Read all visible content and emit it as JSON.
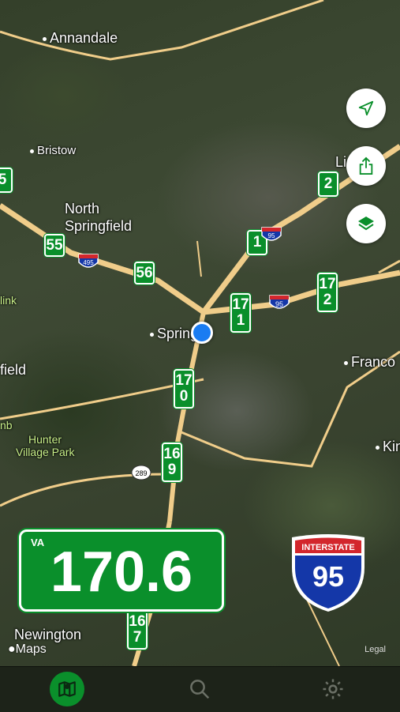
{
  "map": {
    "places": {
      "annandale": "Annandale",
      "bristow": "Bristow",
      "north_springfield_1": "North",
      "north_springfield_2": "Springfield",
      "springfield": "Springfie",
      "springfield_partial": "fi",
      "field_left": "field",
      "franconia": "Franco",
      "hunter_1": "Hunter",
      "hunter_2": "Village Park",
      "newington": "Newington",
      "kingstowne": "Kin",
      "link": "link",
      "lincolnia": "Li",
      "mb": "nb"
    },
    "mile_markers": [
      "5",
      "55",
      "56",
      "1",
      "2",
      "171",
      "172",
      "170",
      "169",
      "167"
    ],
    "shields": {
      "i495": "495",
      "i95": "95",
      "i95b": "95",
      "va289": "289"
    },
    "attribution": "Maps",
    "legal": "Legal"
  },
  "mile_display": {
    "state": "VA",
    "value": "170.6"
  },
  "interstate": {
    "label": "INTERSTATE",
    "number": "95"
  },
  "controls": [
    "location-arrow-icon",
    "share-icon",
    "layers-icon"
  ],
  "tabs": [
    "map-tab",
    "search-tab",
    "settings-tab"
  ],
  "colors": {
    "marker_green": "#0a8f2b",
    "road": "#f0cd8a",
    "location_blue": "#1a7cf2",
    "shield_blue": "#1437a8",
    "shield_red": "#d3262c"
  }
}
